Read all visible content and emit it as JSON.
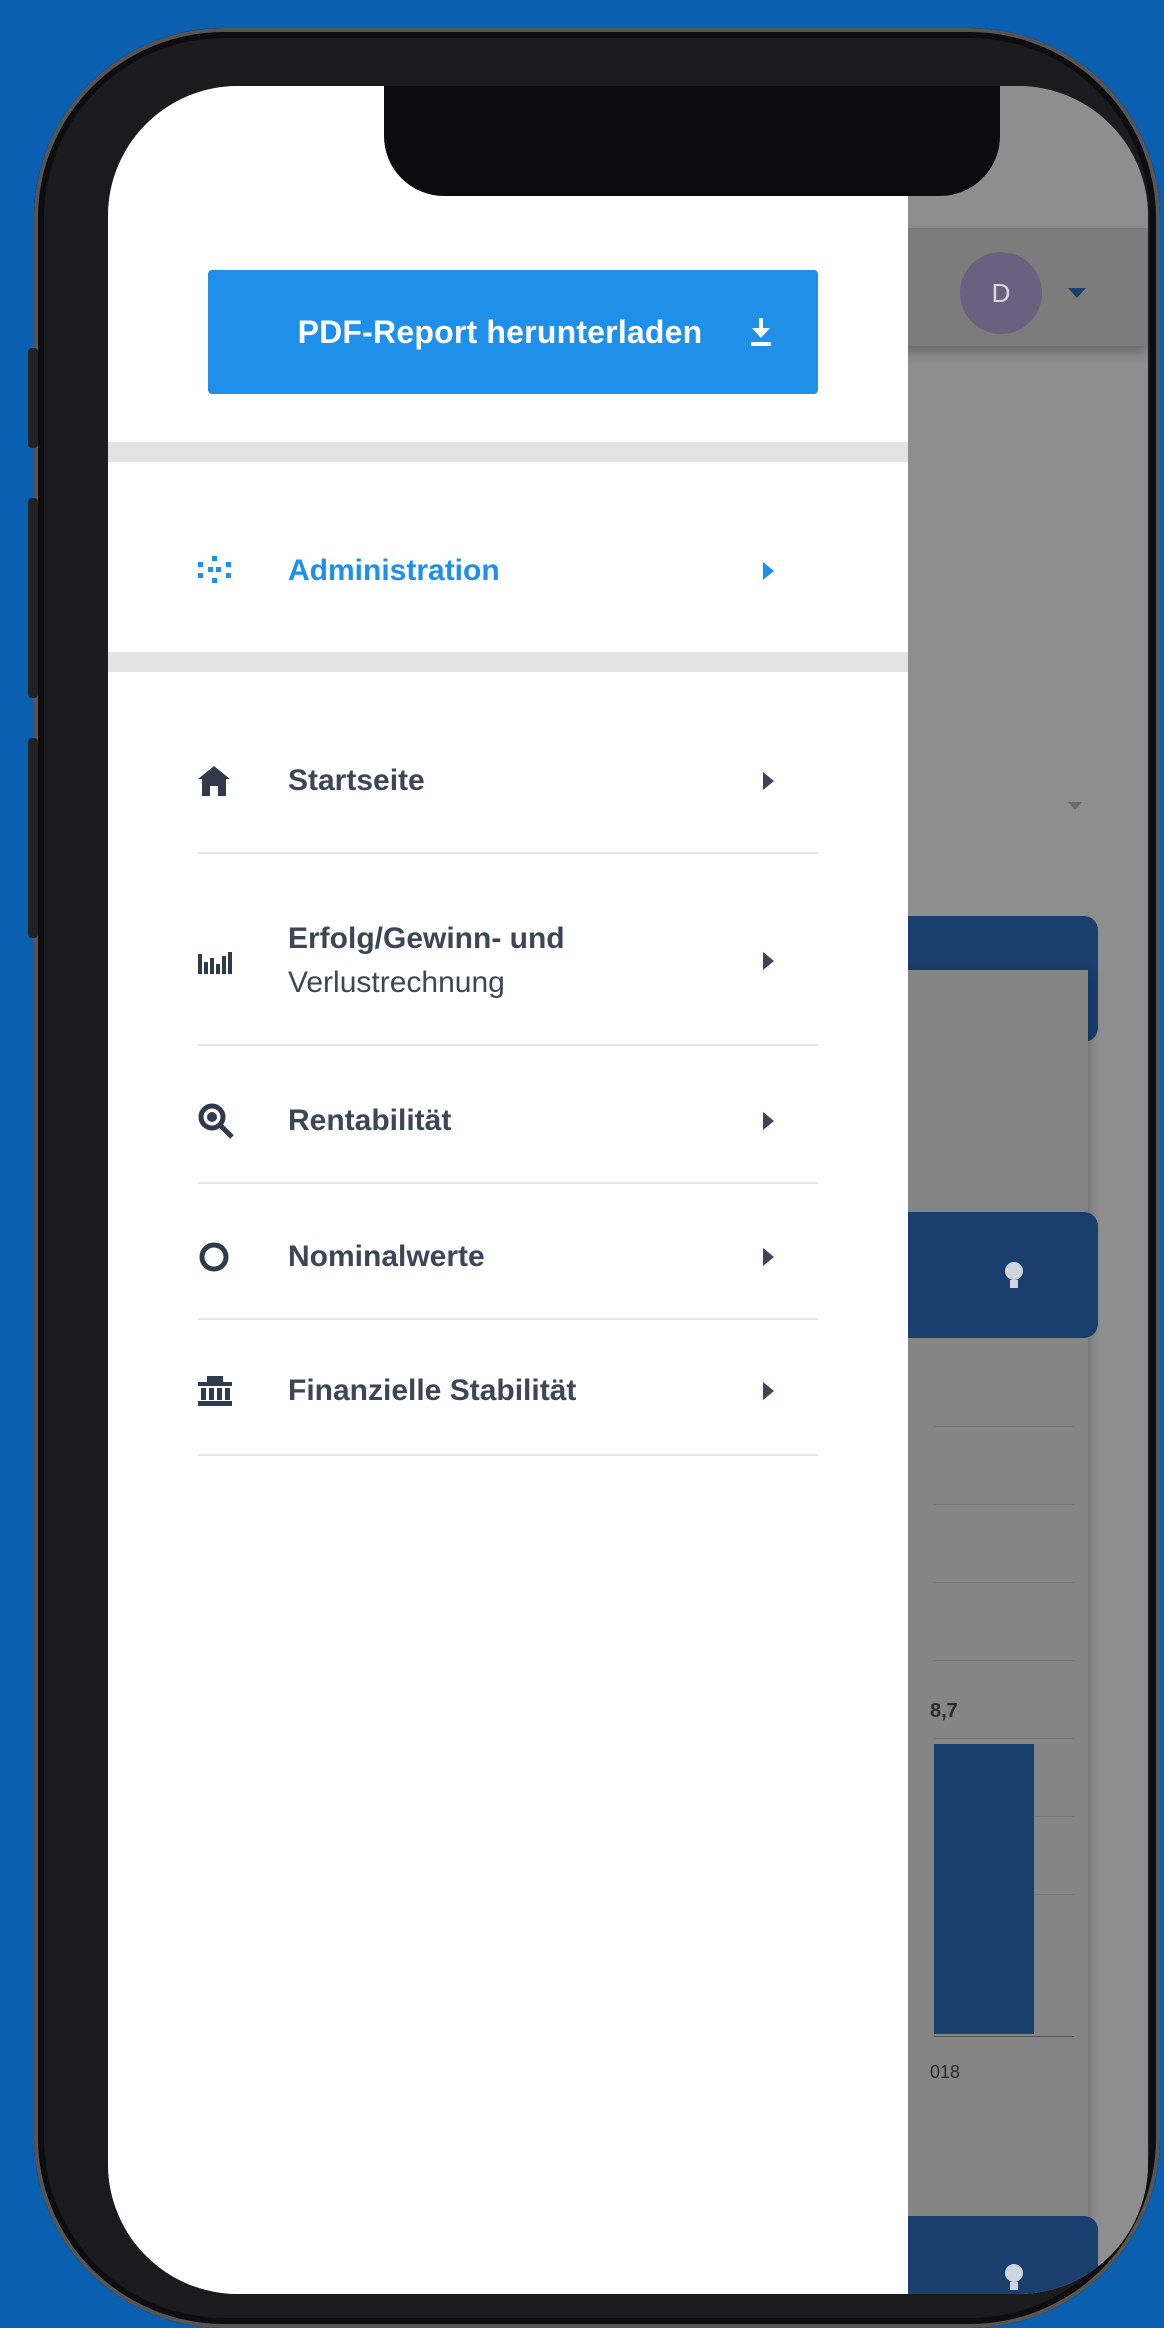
{
  "colors": {
    "accent": "#1e90ea",
    "dark_blue": "#1a3e6d",
    "menu_text": "#3c4656",
    "background": "#0a5fb0"
  },
  "drawer": {
    "pdf_button": {
      "label": "PDF-Report herunterladen",
      "icon": "download-icon"
    },
    "admin_item": {
      "label": "Administration",
      "icon": "admin-dots-icon"
    },
    "items": [
      {
        "label": "Startseite",
        "icon": "home-icon"
      },
      {
        "label": "Erfolg/Gewinn- und",
        "label2": "Verlustrechnung",
        "icon": "bar-chart-icon"
      },
      {
        "label": "Rentabilität",
        "icon": "magnifier-icon"
      },
      {
        "label": "Nominalwerte",
        "icon": "circle-icon"
      },
      {
        "label": "Finanzielle Stabilität",
        "icon": "bank-icon"
      }
    ]
  },
  "background_app": {
    "avatar_initial": "D",
    "bar_value_label": "8,7",
    "axis_label": "018"
  }
}
